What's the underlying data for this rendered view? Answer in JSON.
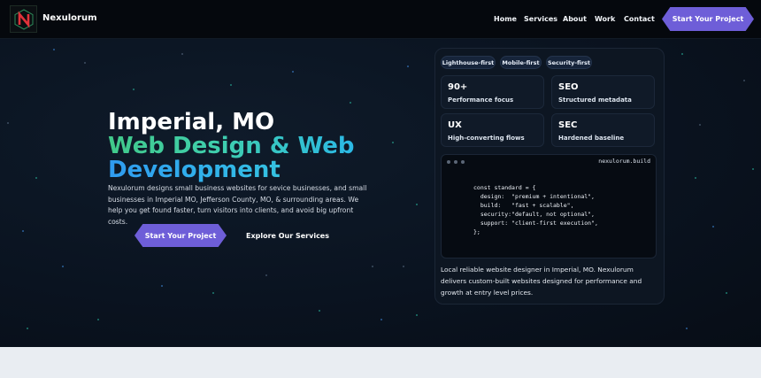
{
  "nav": {
    "brand": "Nexulorum",
    "links": [
      "Home",
      "Services",
      "About",
      "Work",
      "Contact"
    ],
    "cta": "Start Your Project"
  },
  "hero": {
    "title_line1": "Imperial, MO",
    "title_line2": "Web Design & Web",
    "title_line3": "Development",
    "description": "Nexulorum designs small business websites for sevice businesses, and small businesses in Imperial MO, Jefferson County, MO, & surrounding areas. We help you get found faster, turn visitors into clients, and avoid big upfront costs.",
    "cta_primary": "Start Your Project",
    "cta_secondary": "Explore Our Services"
  },
  "panel": {
    "pills": [
      "Lighthouse-first",
      "Mobile-first",
      "Security-first"
    ],
    "stats": [
      {
        "value": "90+",
        "label": "Performance focus"
      },
      {
        "value": "SEO",
        "label": "Structured metadata"
      },
      {
        "value": "UX",
        "label": "High-converting flows"
      },
      {
        "value": "SEC",
        "label": "Hardened baseline"
      }
    ],
    "code_filename": "nexulorum.build",
    "code_lines": [
      "const standard = {",
      "  design:  \"premium + intentional\",",
      "  build:   \"fast + scalable\",",
      "  security:\"default, not optional\",",
      "  support: \"client-first execution\",",
      "};"
    ],
    "note": "Local reliable website designer in Imperial, MO. Nexulorum delivers custom-built websites designed for performance and growth at entry level prices."
  },
  "colors": {
    "accent": "#6e5ed8",
    "gradient_green": "#41c98a",
    "gradient_blue": "#2f9bf0",
    "background_dark": "#0a1320",
    "footer_light": "#e9edf2"
  }
}
